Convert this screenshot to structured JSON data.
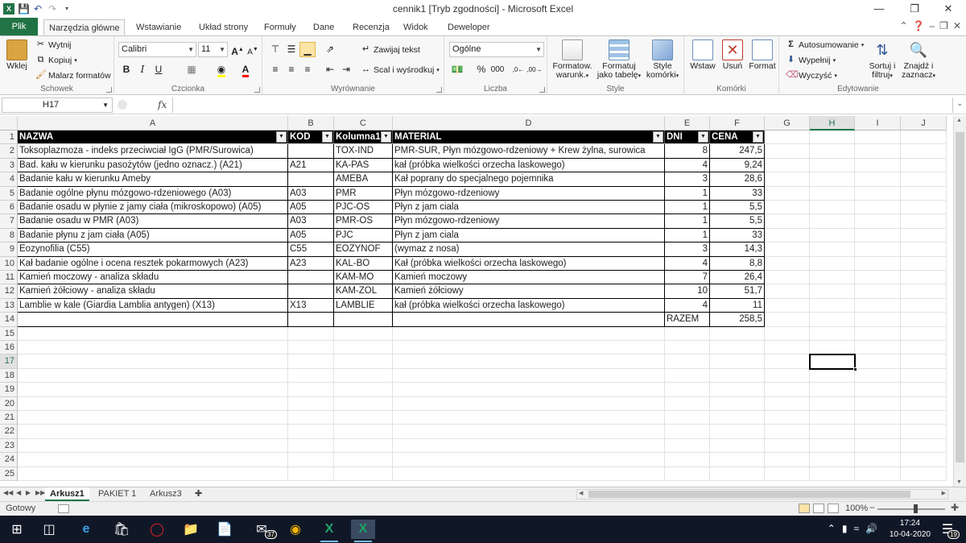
{
  "window": {
    "title": "cennik1  [Tryb zgodności]  -  Microsoft Excel",
    "minimize_icon": "minimize-icon",
    "maximize_icon": "restore-icon",
    "close_icon": "close-icon"
  },
  "ribbon_tabs": {
    "file": "Plik",
    "home": "Narzędzia główne",
    "insert": "Wstawianie",
    "layout": "Układ strony",
    "formulas": "Formuły",
    "data": "Dane",
    "review": "Recenzja",
    "view": "Widok",
    "developer": "Deweloper"
  },
  "ribbon": {
    "clipboard": {
      "label": "Schowek",
      "paste": "Wklej",
      "cut": "Wytnij",
      "copy": "Kopiuj",
      "format_painter": "Malarz formatów"
    },
    "font": {
      "label": "Czcionka",
      "name": "Calibri",
      "size": "11",
      "bold": "B",
      "italic": "I",
      "underline": "U"
    },
    "alignment": {
      "label": "Wyrównanie",
      "wrap": "Zawijaj tekst",
      "merge": "Scal i wyśrodkuj"
    },
    "number": {
      "label": "Liczba",
      "format": "Ogólne",
      "percent": "%",
      "thousands": "000"
    },
    "styles": {
      "label": "Style",
      "conditional": [
        "Formatow.",
        "warunk."
      ],
      "as_table": [
        "Formatuj",
        "jako tabelę"
      ],
      "cell_styles": [
        "Style",
        "komórki"
      ]
    },
    "cells": {
      "label": "Komórki",
      "insert": "Wstaw",
      "delete": "Usuń",
      "format": "Format"
    },
    "editing": {
      "label": "Edytowanie",
      "autosum": "Autosumowanie",
      "fill": "Wypełnij",
      "clear": "Wyczyść",
      "sort": [
        "Sortuj i",
        "filtruj"
      ],
      "find": [
        "Znajdź i",
        "zaznacz"
      ]
    }
  },
  "formula_bar": {
    "name_box": "H17",
    "fx": "fx",
    "value": ""
  },
  "grid": {
    "columns": [
      "A",
      "B",
      "C",
      "D",
      "E",
      "F",
      "G",
      "H",
      "I",
      "J"
    ],
    "selected_column": "H",
    "selected_row": 17,
    "row_numbers": [
      1,
      2,
      3,
      4,
      5,
      6,
      7,
      8,
      9,
      10,
      11,
      12,
      13,
      14,
      15,
      16,
      17,
      18,
      19,
      20,
      21,
      22,
      23,
      24,
      25
    ],
    "headers": [
      "NAZWA",
      "KOD",
      "Kolumna1",
      "MATERIAL",
      "DNI",
      "CENA"
    ],
    "rows": [
      [
        "Toksoplazmoza - indeks przeciwciał IgG (PMR/Surowica)",
        "",
        "TOX-IND",
        "PMR-SUR, Płyn mózgowo-rdzeniowy + Krew żylna, surowica",
        "8",
        "247,5"
      ],
      [
        "Bad. kału w kierunku pasożytów (jedno oznacz.) (A21)",
        "A21",
        "KA-PAS",
        "kał (próbka wielkości orzecha laskowego)",
        "4",
        "9,24"
      ],
      [
        "Badanie kału w kierunku Ameby",
        "",
        "AMEBA",
        "Kał poprany do specjalnego pojemnika",
        "3",
        "28,6"
      ],
      [
        "Badanie ogólne płynu mózgowo-rdzeniowego (A03)",
        "A03",
        "PMR",
        "Płyn mózgowo-rdzeniowy",
        "1",
        "33"
      ],
      [
        "Badanie osadu w płynie z jamy ciała (mikroskopowo) (A05)",
        "A05",
        "PJC-OS",
        "Płyn z jam ciala",
        "1",
        "5,5"
      ],
      [
        "Badanie osadu w PMR (A03)",
        "A03",
        "PMR-OS",
        "Płyn mózgowo-rdzeniowy",
        "1",
        "5,5"
      ],
      [
        "Badanie płynu z jam ciała (A05)",
        "A05",
        "PJC",
        "Płyn z jam ciala",
        "1",
        "33"
      ],
      [
        "Eozynofilia (C55)",
        "C55",
        "EOZYNOF",
        "(wymaz z nosa)",
        "3",
        "14,3"
      ],
      [
        "Kał badanie ogólne i ocena resztek pokarmowych (A23)",
        "A23",
        "KAL-BO",
        "Kał (próbka wielkości orzecha laskowego)",
        "4",
        "8,8"
      ],
      [
        "Kamień moczowy -  analiza składu",
        "",
        "KAM-MO",
        "Kamień moczowy",
        "7",
        "26,4"
      ],
      [
        "Kamień żółciowy - analiza składu",
        "",
        "KAM-ZOL",
        "Kamień żółciowy",
        "10",
        "51,7"
      ],
      [
        "Lamblie w kale (Giardia Lamblia antygen) (X13)",
        "X13",
        "LAMBLIE",
        "kał (próbka wielkości orzecha laskowego)",
        "4",
        "11"
      ]
    ],
    "total_label": "RAZEM",
    "total_value": "258,5"
  },
  "sheets": {
    "tabs": [
      "Arkusz1",
      "PAKIET 1",
      "Arkusz3"
    ],
    "active": "Arkusz1"
  },
  "status": {
    "ready": "Gotowy",
    "zoom": "100%"
  },
  "taskbar": {
    "time": "17:24",
    "date": "10-04-2020",
    "mail_badge": "37",
    "notif_badge": "19"
  }
}
